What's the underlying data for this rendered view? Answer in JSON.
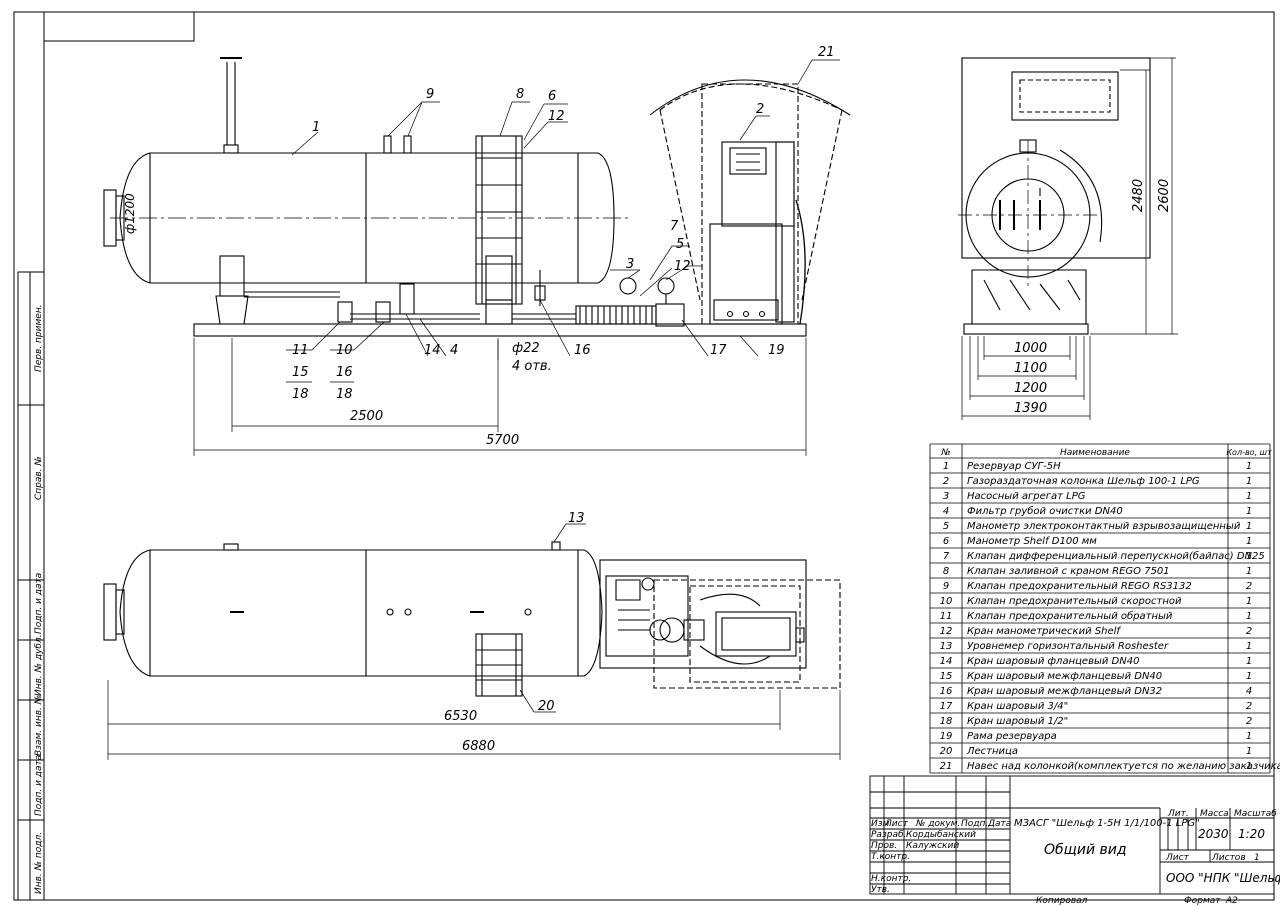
{
  "side_view": {
    "callouts": [
      "1",
      "2",
      "3",
      "4",
      "5",
      "6",
      "7",
      "8",
      "9",
      "10",
      "11",
      "12",
      "12",
      "14",
      "15",
      "16",
      "16",
      "17",
      "18",
      "18",
      "19",
      "21"
    ],
    "diameter_label": "ф1200",
    "pipe_label": "ф22",
    "holes_label": "4 отв.",
    "dim_2500": "2500",
    "dim_5700": "5700"
  },
  "end_view": {
    "dim_1000": "1000",
    "dim_1100": "1100",
    "dim_1200": "1200",
    "dim_1390": "1390",
    "dim_2480": "2480",
    "dim_2600": "2600"
  },
  "plan_view": {
    "callout_13": "13",
    "callout_20": "20",
    "dim_6530": "6530",
    "dim_6880": "6880"
  },
  "side_stamp": [
    "Перв. примен.",
    "Справ. №",
    "Подп. и дата",
    "Инв. № дубл.",
    "Взам. инв. №",
    "Подп. и дата",
    "Инв. № подл."
  ],
  "parts_table": {
    "headers": [
      "№",
      "Наименование",
      "Кол-во, шт"
    ],
    "rows": [
      [
        "1",
        "Резервуар СУГ-5Н",
        "1"
      ],
      [
        "2",
        "Газораздаточная колонка Шельф 100-1 LPG",
        "1"
      ],
      [
        "3",
        "Насосный агрегат LPG",
        "1"
      ],
      [
        "4",
        "Фильтр грубой очистки DN40",
        "1"
      ],
      [
        "5",
        "Манометр электроконтактный взрывозащищенный",
        "1"
      ],
      [
        "6",
        "Манометр Shelf D100 мм",
        "1"
      ],
      [
        "7",
        "Клапан дифференциальный перепускной(байпас) DN25",
        "1"
      ],
      [
        "8",
        "Клапан заливной с краном REGO 7501",
        "1"
      ],
      [
        "9",
        "Клапан предохранительный REGO RS3132",
        "2"
      ],
      [
        "10",
        "Клапан предохранительный скоростной",
        "1"
      ],
      [
        "11",
        "Клапан предохранительный обратный",
        "1"
      ],
      [
        "12",
        "Кран манометрический Shelf",
        "2"
      ],
      [
        "13",
        "Уровнемер горизонтальный Roshester",
        "1"
      ],
      [
        "14",
        "Кран шаровый фланцевый DN40",
        "1"
      ],
      [
        "15",
        "Кран шаровый межфланцевый DN40",
        "1"
      ],
      [
        "16",
        "Кран шаровый межфланцевый DN32",
        "4"
      ],
      [
        "17",
        "Кран шаровый 3/4\"",
        "2"
      ],
      [
        "18",
        "Кран шаровый 1/2\"",
        "2"
      ],
      [
        "19",
        "Рама резервуара",
        "1"
      ],
      [
        "20",
        "Лестница",
        "1"
      ],
      [
        "21",
        "Навес над колонкой(комплектуется по желанию заказчика)",
        "1"
      ]
    ]
  },
  "title_block": {
    "col_izm": "Изм",
    "col_list": "Лист",
    "col_doc": "№ докум.",
    "col_podp": "Подп.",
    "col_date": "Дата",
    "row_razrab": "Разраб.",
    "name_razrab": "Кордыбанский",
    "row_prov": "Пров.",
    "name_prov": "Калужский",
    "row_tkontr": "Т.контр.",
    "row_nkontr": "Н.контр.",
    "row_utv": "Утв.",
    "designation": "МЗАСГ \"Шельф 1-5Н 1/1/100-1 LPG\"",
    "doc_title": "Общий вид",
    "lit_label": "Лит.",
    "mass_label": "Масса",
    "scale_label": "Масштаб",
    "mass_value": "2030",
    "scale_value": "1:20",
    "sheet_label": "Лист",
    "sheets_label": "Листов",
    "sheets_value": "1",
    "org": "ООО \"НПК \"Шельф\"",
    "copied": "Копировал",
    "format_label": "Формат",
    "format_value": "A2"
  }
}
